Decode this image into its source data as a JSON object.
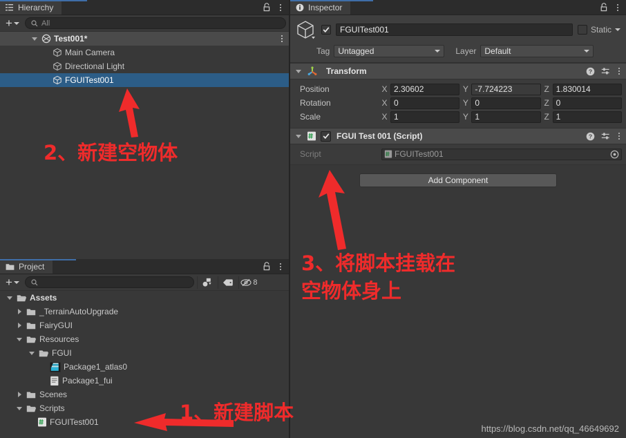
{
  "hierarchy": {
    "tab_label": "Hierarchy",
    "tab_icon": "hierarchy-icon",
    "lock_icon": "lock-icon",
    "menu_icon": "kebab-menu-icon",
    "add_label": "+",
    "search_placeholder": "All",
    "search_value": "",
    "search_icon": "search-icon",
    "scene": {
      "label": "Test001*",
      "icon": "scene-icon"
    },
    "items": [
      {
        "label": "Main Camera",
        "icon": "gameobject-cube-icon",
        "indent": 2,
        "selected": false
      },
      {
        "label": "Directional Light",
        "icon": "gameobject-cube-icon",
        "indent": 2,
        "selected": false
      },
      {
        "label": "FGUITest001",
        "icon": "gameobject-cube-icon",
        "indent": 2,
        "selected": true
      }
    ]
  },
  "inspector": {
    "tab_label": "Inspector",
    "tab_icon": "info-icon",
    "lock_icon": "lock-icon",
    "menu_icon": "kebab-menu-icon",
    "object_icon": "gameobject-cube-icon",
    "enabled_checked": true,
    "name_value": "FGUITest001",
    "static_label": "Static",
    "static_checked": false,
    "tag_label": "Tag",
    "tag_value": "Untagged",
    "layer_label": "Layer",
    "layer_value": "Default",
    "transform": {
      "title": "Transform",
      "icon": "transform-gizmo-icon",
      "help_icon": "help-icon",
      "preset_icon": "preset-icon",
      "menu_icon": "kebab-menu-icon",
      "rows": [
        {
          "name": "Position",
          "x": "2.30602",
          "y": "-7.724223",
          "z": "1.830014"
        },
        {
          "name": "Rotation",
          "x": "0",
          "y": "0",
          "z": "0"
        },
        {
          "name": "Scale",
          "x": "1",
          "y": "1",
          "z": "1"
        }
      ],
      "axes": [
        "X",
        "Y",
        "Z"
      ]
    },
    "script_component": {
      "title": "FGUI Test 001 (Script)",
      "icon": "csharp-script-icon",
      "enabled_checked": true,
      "help_icon": "help-icon",
      "preset_icon": "preset-icon",
      "menu_icon": "kebab-menu-icon",
      "field_label": "Script",
      "field_value": "FGUITest001",
      "field_icon": "csharp-script-icon",
      "picker_icon": "object-picker-icon"
    },
    "add_component_label": "Add Component"
  },
  "project": {
    "tab_label": "Project",
    "tab_icon": "folder-icon",
    "lock_icon": "lock-icon",
    "menu_icon": "kebab-menu-icon",
    "add_label": "+",
    "search_placeholder": "",
    "search_value": "",
    "search_icon": "search-icon",
    "filter_type_icon": "shape-filter-icon",
    "filter_label_icon": "tag-filter-icon",
    "hidden_count_icon": "eye-off-icon",
    "hidden_count": "8",
    "tree": [
      {
        "label": "Assets",
        "icon": "folder-open-icon",
        "indent": 0,
        "arrow": "down",
        "bold": true
      },
      {
        "label": "_TerrainAutoUpgrade",
        "icon": "folder-closed-icon",
        "indent": 1,
        "arrow": "right",
        "bold": false
      },
      {
        "label": "FairyGUI",
        "icon": "folder-closed-icon",
        "indent": 1,
        "arrow": "right",
        "bold": false
      },
      {
        "label": "Resources",
        "icon": "folder-open-icon",
        "indent": 1,
        "arrow": "down",
        "bold": false
      },
      {
        "label": "FGUI",
        "icon": "folder-open-icon",
        "indent": 2,
        "arrow": "down",
        "bold": false
      },
      {
        "label": "Package1_atlas0",
        "icon": "texture-asset-icon",
        "indent": 3,
        "arrow": "none",
        "bold": false
      },
      {
        "label": "Package1_fui",
        "icon": "text-asset-icon",
        "indent": 3,
        "arrow": "none",
        "bold": false
      },
      {
        "label": "Scenes",
        "icon": "folder-closed-icon",
        "indent": 1,
        "arrow": "right",
        "bold": false
      },
      {
        "label": "Scripts",
        "icon": "folder-open-icon",
        "indent": 1,
        "arrow": "down",
        "bold": false
      },
      {
        "label": "FGUITest001",
        "icon": "csharp-script-icon",
        "indent": 2,
        "arrow": "none",
        "bold": false
      }
    ]
  },
  "annotations": {
    "color": "#ef2b2b",
    "step1": "1、新建脚本",
    "step2": "2、新建空物体",
    "step3_line1": "3、将脚本挂载在",
    "step3_line2": "空物体身上"
  },
  "watermark": "https://blog.csdn.net/qq_46649692"
}
